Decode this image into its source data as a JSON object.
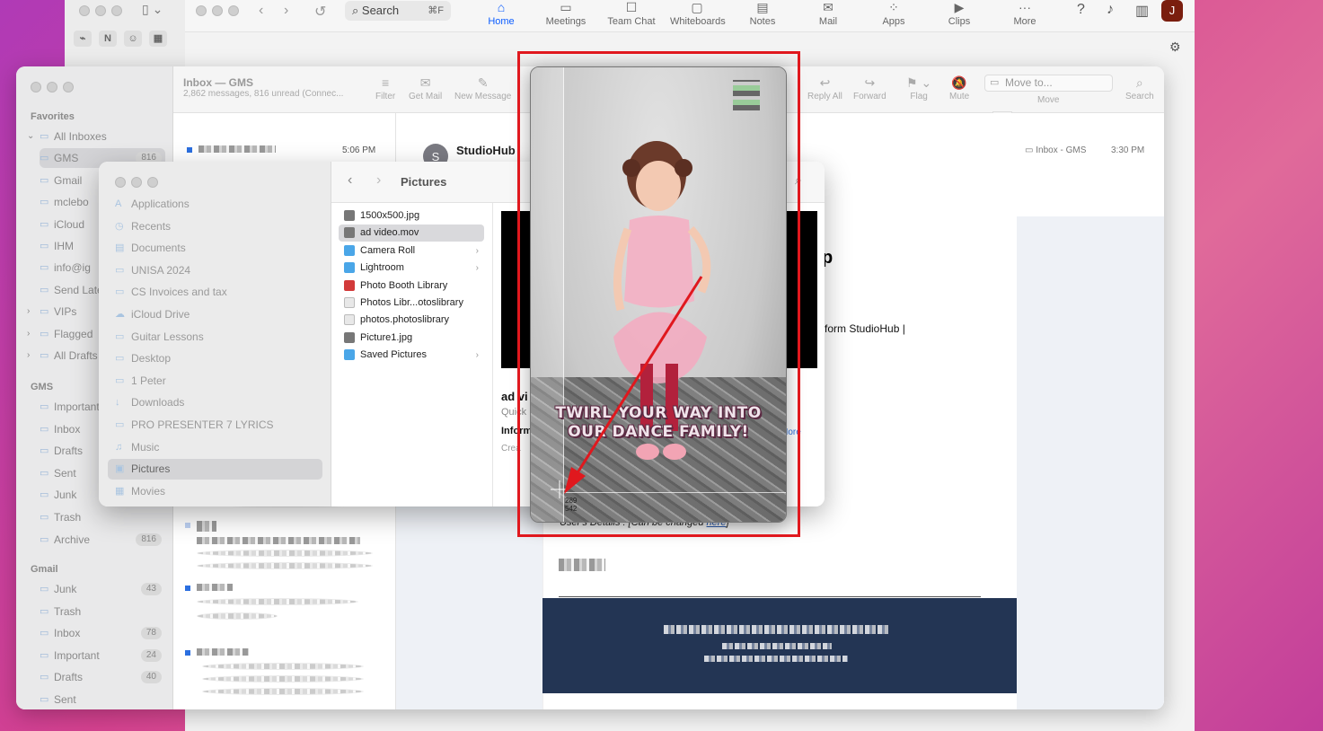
{
  "zoom": {
    "search_label": "Search",
    "search_shortcut": "⌘F",
    "tabs": [
      {
        "label": "Home",
        "icon": "home-icon"
      },
      {
        "label": "Meetings",
        "icon": "video-icon"
      },
      {
        "label": "Team Chat",
        "icon": "chat-icon"
      },
      {
        "label": "Whiteboards",
        "icon": "whiteboard-icon"
      },
      {
        "label": "Notes",
        "icon": "notes-icon"
      },
      {
        "label": "Mail",
        "icon": "mail-icon"
      },
      {
        "label": "Apps",
        "icon": "apps-icon"
      },
      {
        "label": "Clips",
        "icon": "clips-icon"
      },
      {
        "label": "More",
        "icon": "more-icon"
      }
    ],
    "avatar_letter": "J",
    "accent": "#0b5cff"
  },
  "mail": {
    "title": "Inbox — GMS",
    "subtitle": "2,862 messages, 816 unread (Connec...",
    "toolbar": {
      "filter": "Filter",
      "get_mail": "Get Mail",
      "new_message": "New Message",
      "reply_all": "Reply All",
      "forward": "Forward",
      "flag": "Flag",
      "mute": "Mute",
      "move_to": "Move to...",
      "move": "Move",
      "search": "Search"
    },
    "sidebar": {
      "favorites_label": "Favorites",
      "gms_label": "GMS",
      "gmail_label": "Gmail",
      "favorites": [
        {
          "label": "All Inboxes",
          "count": ""
        },
        {
          "label": "GMS",
          "count": "816"
        },
        {
          "label": "Gmail",
          "count": ""
        },
        {
          "label": "mclebo",
          "count": ""
        },
        {
          "label": "iCloud",
          "count": ""
        },
        {
          "label": "IHM",
          "count": ""
        },
        {
          "label": "info@ig",
          "count": ""
        },
        {
          "label": "Send Late",
          "count": ""
        },
        {
          "label": "VIPs",
          "count": ""
        },
        {
          "label": "Flagged",
          "count": ""
        },
        {
          "label": "All Drafts",
          "count": ""
        }
      ],
      "gms": [
        {
          "label": "Important",
          "count": ""
        },
        {
          "label": "Inbox",
          "count": ""
        },
        {
          "label": "Drafts",
          "count": ""
        },
        {
          "label": "Sent",
          "count": ""
        },
        {
          "label": "Junk",
          "count": ""
        },
        {
          "label": "Trash",
          "count": ""
        },
        {
          "label": "Archive",
          "count": "816"
        }
      ],
      "gmail": [
        {
          "label": "Junk",
          "count": "43"
        },
        {
          "label": "Trash",
          "count": ""
        },
        {
          "label": "Inbox",
          "count": "78"
        },
        {
          "label": "Important",
          "count": "24"
        },
        {
          "label": "Drafts",
          "count": "40"
        },
        {
          "label": "Sent",
          "count": ""
        }
      ]
    },
    "message_time": "5:06 PM",
    "reading": {
      "sender_initial": "S",
      "sender_name": "StudioHub",
      "mailbox_tag": "Inbox - GMS",
      "time": "3:30 PM",
      "bold_fragment": "p",
      "studio_text": "form StudioHub |",
      "user_details": "User's Details : [Can be changed ",
      "user_details_link": "here",
      "user_details_end": "]"
    }
  },
  "finder": {
    "title": "Pictures",
    "sidebar": [
      {
        "label": "Applications",
        "icon": "applications-icon"
      },
      {
        "label": "Recents",
        "icon": "clock-icon"
      },
      {
        "label": "Documents",
        "icon": "document-icon"
      },
      {
        "label": "UNISA 2024",
        "icon": "folder-icon"
      },
      {
        "label": "CS Invoices and tax",
        "icon": "folder-icon"
      },
      {
        "label": "iCloud Drive",
        "icon": "cloud-icon"
      },
      {
        "label": "Guitar Lessons",
        "icon": "folder-icon"
      },
      {
        "label": "Desktop",
        "icon": "desktop-icon"
      },
      {
        "label": "1 Peter",
        "icon": "folder-icon"
      },
      {
        "label": "Downloads",
        "icon": "download-icon"
      },
      {
        "label": "PRO PRESENTER 7 LYRICS",
        "icon": "folder-icon"
      },
      {
        "label": "Music",
        "icon": "music-icon"
      },
      {
        "label": "Pictures",
        "icon": "pictures-icon"
      },
      {
        "label": "Movies",
        "icon": "movies-icon"
      }
    ],
    "files": [
      {
        "name": "1500x500.jpg",
        "kind": "file",
        "folder": false
      },
      {
        "name": "ad video.mov",
        "kind": "file",
        "folder": false
      },
      {
        "name": "Camera Roll",
        "kind": "folder",
        "folder": true
      },
      {
        "name": "Lightroom",
        "kind": "folder",
        "folder": true
      },
      {
        "name": "Photo Booth Library",
        "kind": "red",
        "folder": false
      },
      {
        "name": "Photos Libr...otoslibrary",
        "kind": "doc",
        "folder": false
      },
      {
        "name": "photos.photoslibrary",
        "kind": "doc",
        "folder": false
      },
      {
        "name": "Picture1.jpg",
        "kind": "file",
        "folder": false
      },
      {
        "name": "Saved Pictures",
        "kind": "folder",
        "folder": true
      }
    ],
    "preview": {
      "name": "ad vi",
      "kind": "Quick",
      "info": "Inform",
      "more": "w More",
      "created": "Crea"
    }
  },
  "quicklook": {
    "caption_line1": "TWIRL YOUR WAY INTO",
    "caption_line2": "OUR DANCE FAMILY!",
    "coord_x": "289",
    "coord_y": "542"
  },
  "colors": {
    "highlight": "#e0181e",
    "arrow": "#e0181e",
    "footer": "#233554"
  }
}
